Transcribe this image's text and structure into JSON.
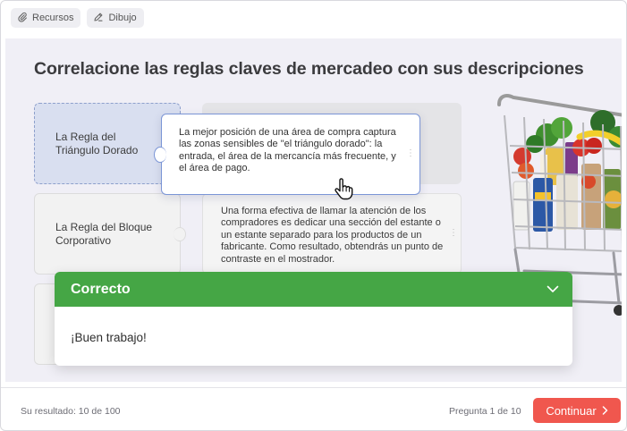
{
  "toolbar": {
    "resources_label": "Recursos",
    "drawing_label": "Dibujo"
  },
  "question": {
    "title": "Correlacione las reglas claves de mercadeo con sus descripciones"
  },
  "terms": [
    {
      "label": "La Regla del Triángulo Dorado"
    },
    {
      "label": "La Regla del Bloque Corporativo"
    },
    {
      "label": ""
    }
  ],
  "descriptions": [
    {
      "text": "La mejor posición de una área de compra captura las zonas sensibles de \"el triángulo dorado\": la entrada, el área de la mercancía más frecuente, y el área de pago."
    },
    {
      "text": "Una forma efectiva de llamar la atención de los compradores es dedicar una sección del estante o un estante separado para los productos de un fabricante. Como resultado, obtendrás un punto de contraste en el mostrador."
    }
  ],
  "feedback": {
    "title": "Correcto",
    "message": "¡Buen trabajo!",
    "color": "#45a645"
  },
  "footer": {
    "score": "Su resultado: 10 de 100",
    "question_counter": "Pregunta 1 de 10",
    "continue_label": "Continuar",
    "continue_color": "#f0574e"
  },
  "icons": {
    "resources": "paperclip-icon",
    "drawing": "pencil-icon",
    "collapse": "chevron-down-icon",
    "continue": "chevron-right-icon",
    "cursor": "hand-pointer-icon"
  }
}
